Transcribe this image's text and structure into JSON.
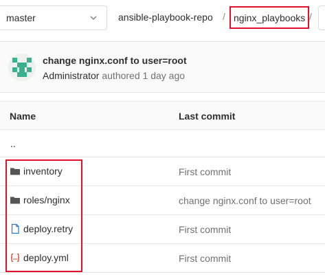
{
  "branch": {
    "name": "master"
  },
  "breadcrumb": {
    "repo": "ansible-playbook-repo",
    "sep1": "/",
    "current": "nginx_playbooks",
    "sep2": "/"
  },
  "commit": {
    "title": "change nginx.conf to user=root",
    "author": "Administrator",
    "action": "authored",
    "time": "1 day ago"
  },
  "table": {
    "headers": {
      "name": "Name",
      "last_commit": "Last commit"
    },
    "parent": "..",
    "rows": [
      {
        "name": "inventory",
        "icon": "folder-icon",
        "last_commit": "First commit"
      },
      {
        "name": "roles/nginx",
        "icon": "folder-icon",
        "last_commit": "change nginx.conf to user=root"
      },
      {
        "name": "deploy.retry",
        "icon": "file-icon",
        "last_commit": "First commit"
      },
      {
        "name": "deploy.yml",
        "icon": "code-file-icon",
        "last_commit": "First commit"
      }
    ]
  },
  "colors": {
    "highlight": "#e0102a",
    "file_icon": "#1f78d1",
    "code_icon": "#db3b21",
    "folder_icon": "#555555"
  }
}
